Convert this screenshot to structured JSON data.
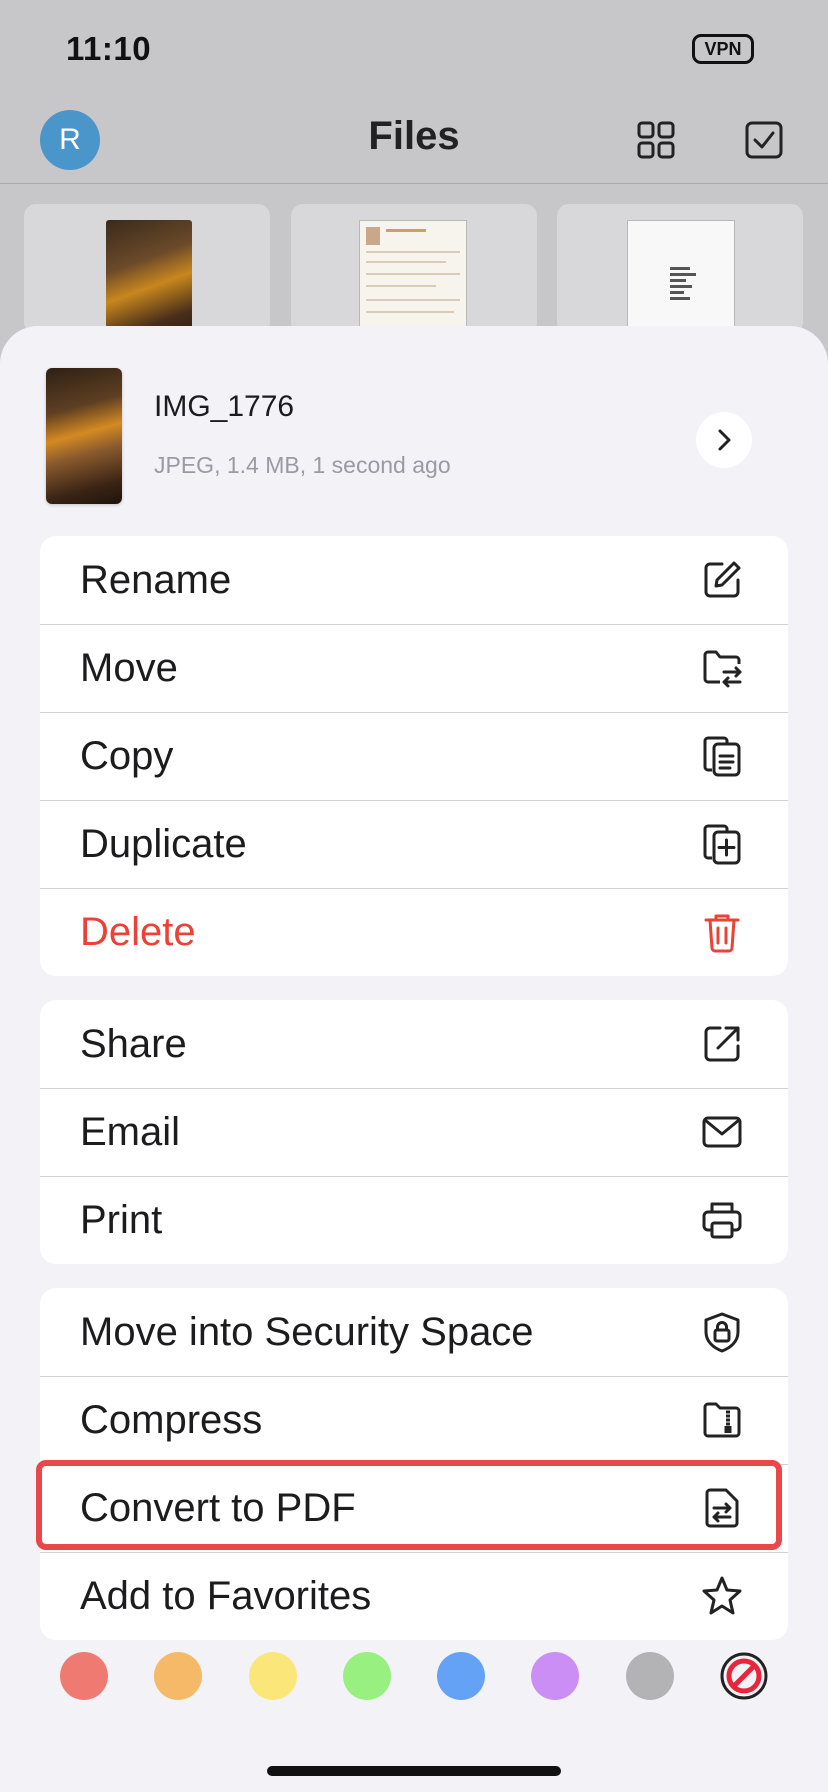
{
  "status_bar": {
    "time": "11:10",
    "vpn": "VPN"
  },
  "nav": {
    "avatar_letter": "R",
    "title": "Files",
    "grid_icon": "grid-view-icon",
    "select_icon": "select-checkbox-icon"
  },
  "file": {
    "name": "IMG_1776",
    "meta": "JPEG, 1.4 MB, 1 second ago"
  },
  "groups": [
    {
      "items": [
        {
          "label": "Rename",
          "icon": "rename-icon"
        },
        {
          "label": "Move",
          "icon": "move-folder-icon"
        },
        {
          "label": "Copy",
          "icon": "copy-icon"
        },
        {
          "label": "Duplicate",
          "icon": "duplicate-icon"
        },
        {
          "label": "Delete",
          "icon": "trash-icon"
        }
      ]
    },
    {
      "items": [
        {
          "label": "Share",
          "icon": "share-icon"
        },
        {
          "label": "Email",
          "icon": "mail-icon"
        },
        {
          "label": "Print",
          "icon": "printer-icon"
        }
      ]
    },
    {
      "items": [
        {
          "label": "Move into Security Space",
          "icon": "shield-lock-icon"
        },
        {
          "label": "Compress",
          "icon": "zip-folder-icon"
        },
        {
          "label": "Convert to PDF",
          "icon": "convert-document-icon"
        },
        {
          "label": "Add to Favorites",
          "icon": "star-icon"
        }
      ]
    }
  ],
  "tag_colors": [
    "#ee7a72",
    "#f5b968",
    "#fbe67a",
    "#97f07f",
    "#64a2f5",
    "#cb8ef5",
    "#b3b3b6"
  ],
  "accent": {
    "danger": "#ea4335",
    "highlight": "#e8484a",
    "avatar": "#4a95c9"
  }
}
